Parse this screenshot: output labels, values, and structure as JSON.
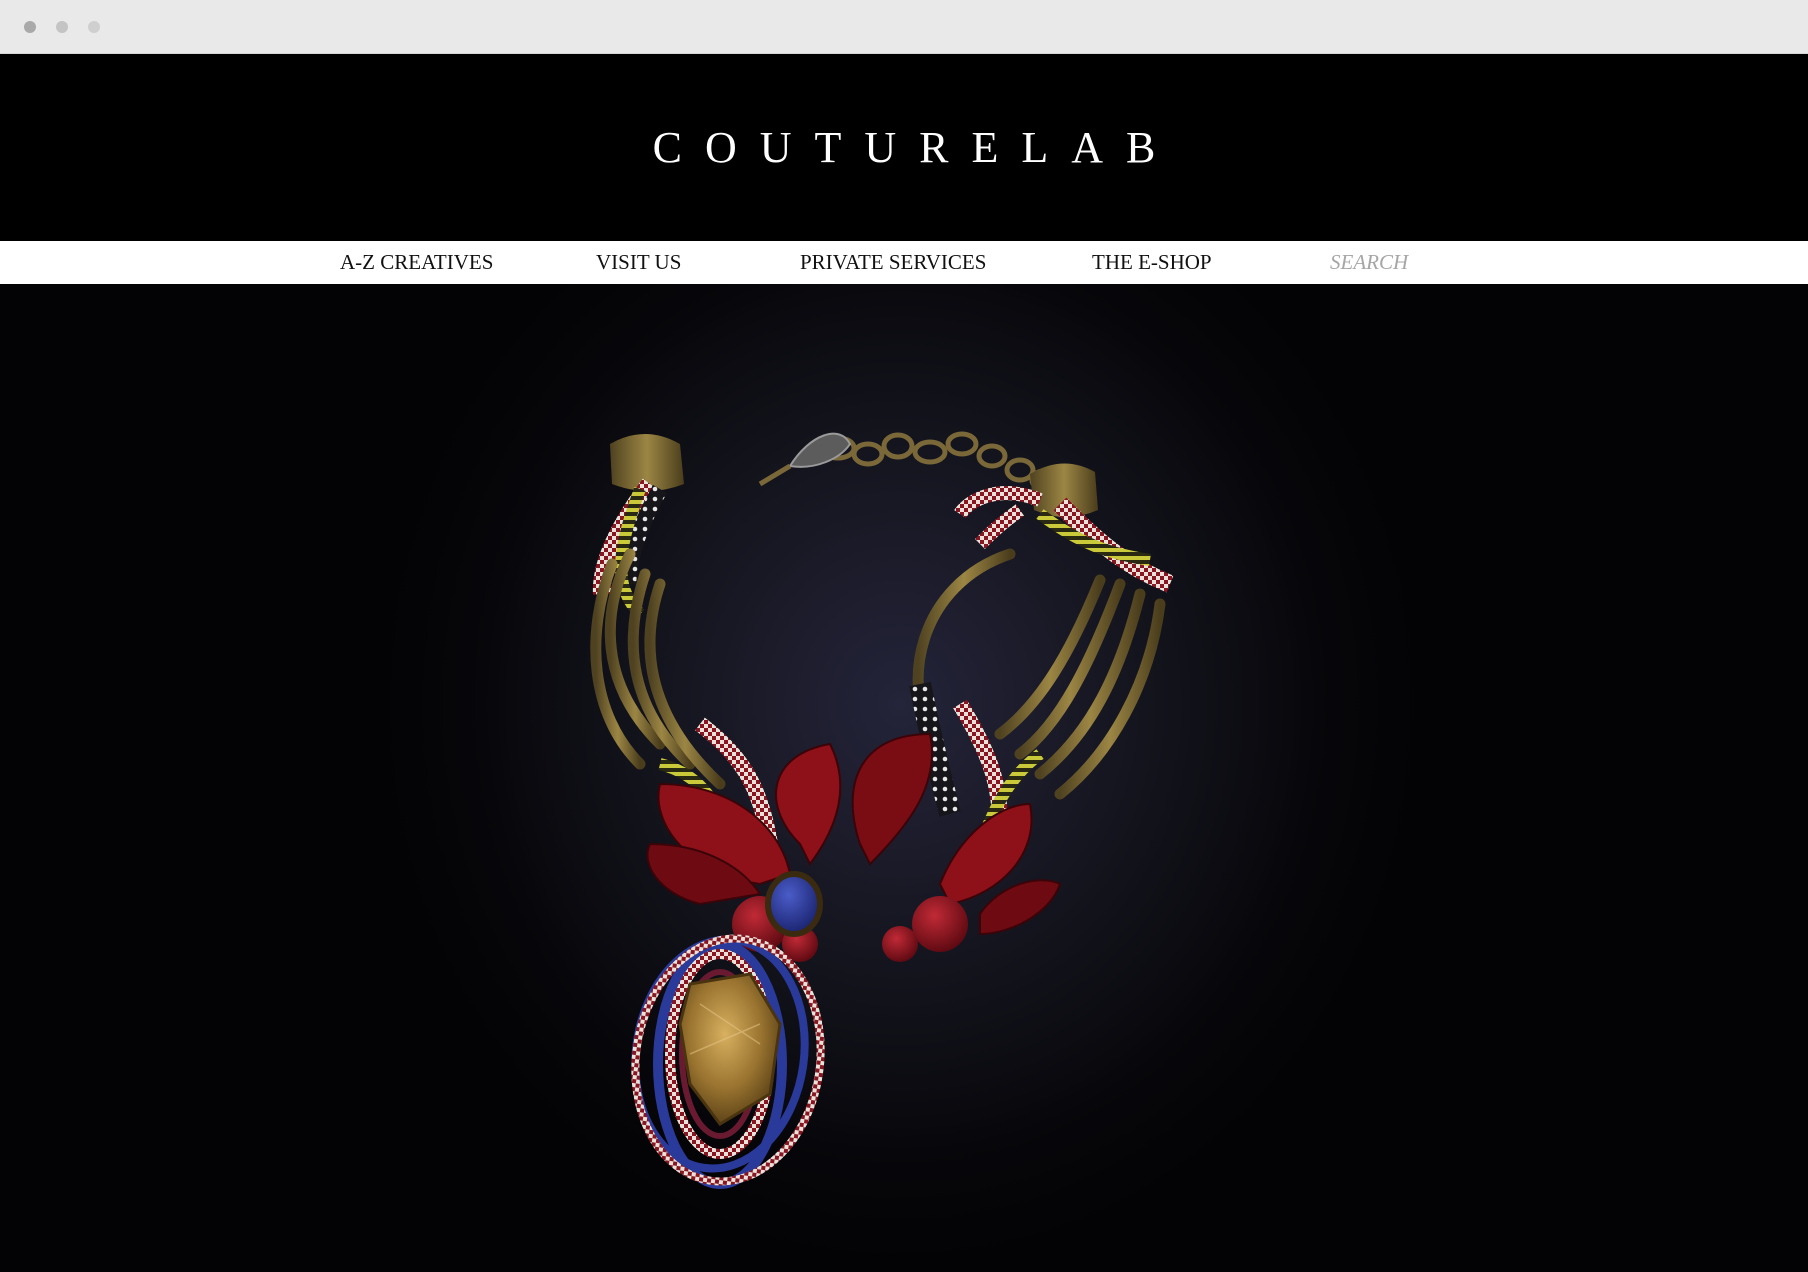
{
  "window": {
    "controls": [
      "close-dot",
      "minimize-dot",
      "maximize-dot"
    ]
  },
  "header": {
    "logo_text": "COUTURELAB"
  },
  "nav": {
    "items": [
      {
        "label": "A-Z CREATIVES"
      },
      {
        "label": "VISIT US"
      },
      {
        "label": "PRIVATE SERVICES"
      },
      {
        "label": "THE E-SHOP"
      }
    ],
    "search_placeholder": "SEARCH"
  },
  "hero": {
    "image": "necklace-photo",
    "colors": {
      "background": "#0b0b12",
      "brass": "#8a7436",
      "red": "#8e1018",
      "yellow": "#c9c93a",
      "lapis": "#2a3a9a",
      "amber": "#b08838"
    }
  }
}
